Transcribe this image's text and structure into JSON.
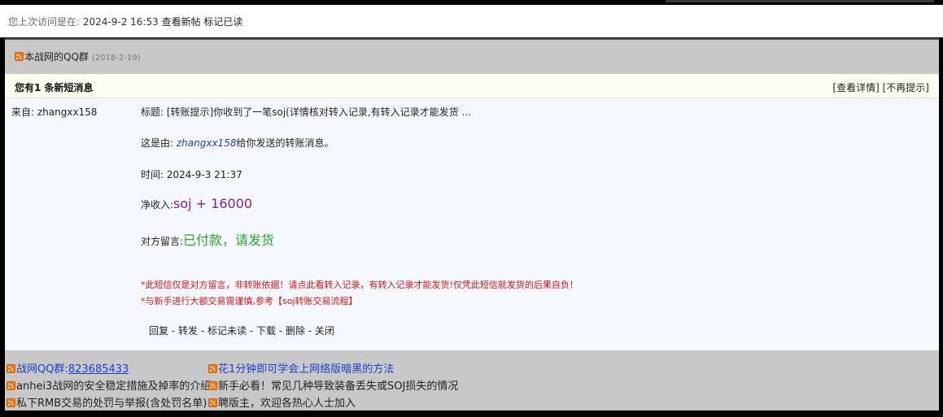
{
  "visit": {
    "label": "您上次访问是在:",
    "time": "2024-9-2 16:53",
    "new_posts": "查看新帖",
    "mark_read": "标记已读"
  },
  "announcement": {
    "title": "本战网的QQ群",
    "date": "(2018-2-19)"
  },
  "pm": {
    "header": "您有1 条新短消息",
    "view_detail": "[查看详情]",
    "no_remind": "[不再提示]",
    "from_label": "来自: zhangxx158",
    "subject": "标题: [转账提示]你收到了一笔soj(详情核对转入记录,有转入记录才能发货 ...",
    "sender_prefix": "这是由: ",
    "sender_name": "zhangxx158",
    "sender_suffix": "给你发送的转账消息。",
    "time": "时间: 2024-9-3 21:37",
    "income_label": "净收入:",
    "income_value": "soj + 16000",
    "message_label": "对方留言:",
    "message_value": "已付款，请发货",
    "warning_1": "*此短信仅是对方留言，非转账依据！请点此看转入记录，有转入记录才能发货!仅凭此短信就发货的后果自负！",
    "warning_2": "*与新手进行大额交易需谨慎,参考【soj转账交易流程】",
    "ops": [
      "回复",
      "转发",
      "标记未读",
      "下载",
      "删除",
      "关闭"
    ],
    "ops_sep": " - "
  },
  "links": {
    "qq_label": "战网QQ群:",
    "qq_number": "823685433",
    "dark_method": "花1分钟即可学会上网络版暗黑的方法",
    "security": "anhei3战网的安全稳定措施及掉率的介绍",
    "newbie": "新手必看！常见几种导致装备丢失或SOJ损失的情况",
    "rmb_report": "私下RMB交易的处罚与举报(含处罚名单)",
    "moderator": "聘版主，欢迎各热心人士加入"
  },
  "icons": {
    "feed": "rss-icon"
  }
}
